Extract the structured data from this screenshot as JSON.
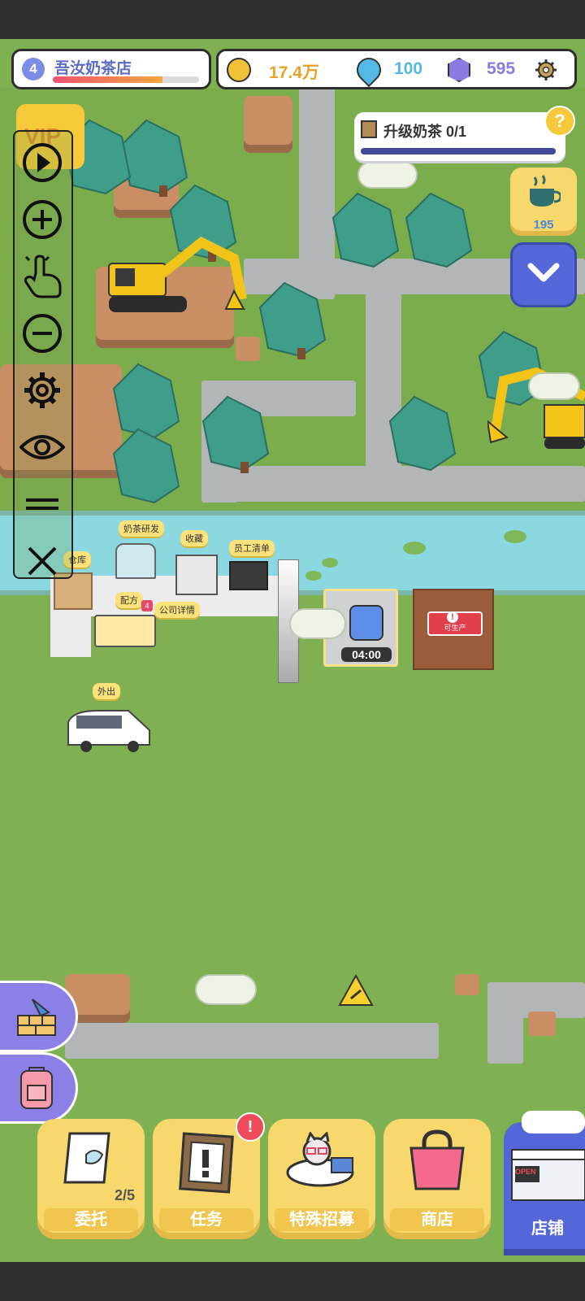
{
  "status_bar": {
    "shop_level": "4",
    "shop_name": "吾汝奶茶店",
    "gold": "17.4万",
    "drops": "100",
    "gems": "595"
  },
  "quest": {
    "label": "升级奶茶 0/1",
    "progress": 0.0
  },
  "side_buttons": {
    "tea_count": "195"
  },
  "map_labels": {
    "warehouse": "仓库",
    "research": "奶茶研发",
    "collection": "收藏",
    "staff_list": "员工清单",
    "recipe": "配方",
    "company": "公司详情",
    "outing": "外出",
    "produce": "可生产",
    "timer": "04:00",
    "company_badge": "4"
  },
  "bottom_nav": {
    "commission": "委托",
    "commission_count": "2/5",
    "tasks": "任务",
    "recruit": "特殊招募",
    "shop": "商店",
    "store": "店铺",
    "open_sign": "OPEN"
  },
  "vip_label": "VIP",
  "colors": {
    "accent": "#f8d76c",
    "gold": "#e9a329",
    "drop": "#54b7e6",
    "gem": "#8a7be0",
    "progress": "#f35a5a"
  }
}
